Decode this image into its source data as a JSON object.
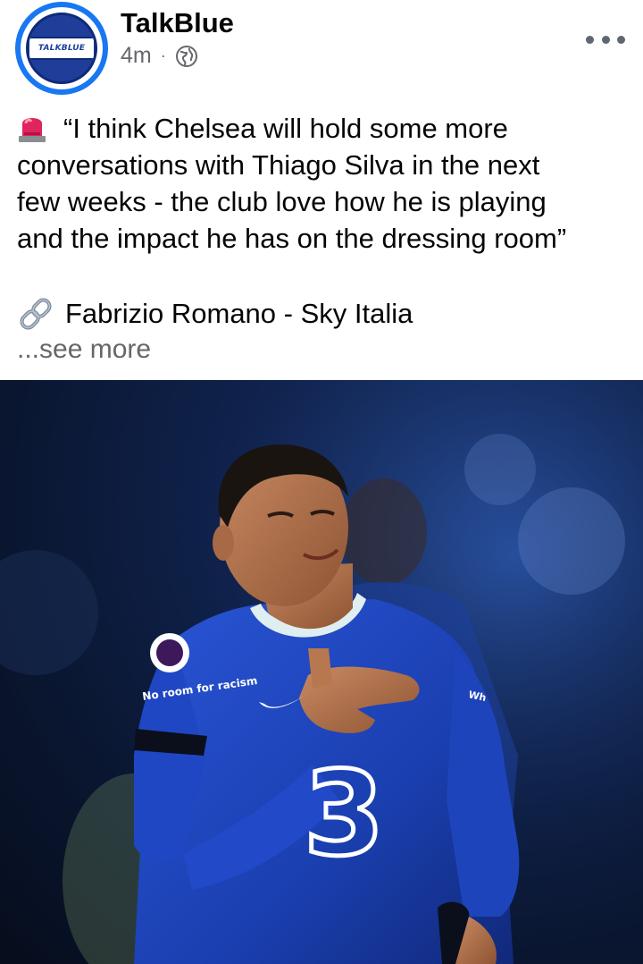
{
  "post": {
    "page_name": "TalkBlue",
    "avatar_text": "TALKBLUE",
    "time": "4m",
    "separator": "·",
    "privacy_icon": "globe-icon",
    "menu_icon": "more-horizontal-icon",
    "lines": [
      "“I think Chelsea will hold some more",
      "conversations with Thiago Silva in the next",
      "few weeks - the club love how he is playing",
      "and the impact he has on the dressing room”"
    ],
    "source": "Fabrizio Romano - Sky Italia",
    "see_more": "...see more",
    "photo": {
      "description_icon": "football-player-photo",
      "shirt_sponsor": "3",
      "sleeve_text": "No room for racism",
      "sleeve_text_2": "Wh"
    }
  },
  "colors": {
    "brand_blue": "#1877f2",
    "secondary_text": "#65676b",
    "primary_text": "#050505",
    "kit_blue": "#1a3fb0"
  }
}
